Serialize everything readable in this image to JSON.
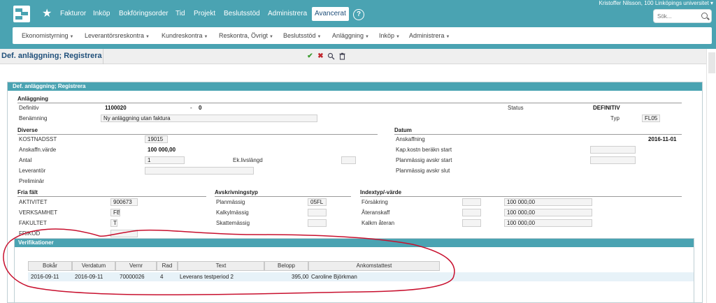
{
  "header": {
    "nav": [
      "Fakturor",
      "Inköp",
      "Bokföringsorder",
      "Tid",
      "Projekt",
      "Beslutsstöd",
      "Administrera",
      "Avancerat"
    ],
    "active_nav": "Avancerat",
    "help_label": "?",
    "user": "Kristoffer Nilsson, 100 Linköpings universitet ▾",
    "search_placeholder": "Sök..."
  },
  "subnav": [
    "Ekonomistyrning",
    "Leverantörsreskontra",
    "Kundreskontra",
    "Reskontra, Övrigt",
    "Beslutsstöd",
    "Anläggning",
    "Inköp",
    "Administrera"
  ],
  "page_title": "Def. anläggning; Registrera",
  "toolbar": {
    "ok": "✔",
    "cancel": "✖"
  },
  "panel": {
    "title": "Def. anläggning; Registrera",
    "anlaggning": {
      "section": "Anläggning",
      "definitiv_label": "Definitiv",
      "definitiv_value": "1100020",
      "definitiv_dash": "-",
      "definitiv_suffix": "0",
      "status_label": "Status",
      "status_value": "DEFINITIV",
      "benamning_label": "Benämning",
      "benamning_value": "Ny anläggning utan faktura",
      "typ_label": "Typ",
      "typ_value": "FL05"
    },
    "diverse": {
      "section": "Diverse",
      "kostnadsst_label": "KOSTNADSST",
      "kostnadsst_value": "19015",
      "anskaffn_label": "Anskaffn.värde",
      "anskaffn_value": "100 000,00",
      "antal_label": "Antal",
      "antal_value": "1",
      "eklivs_label": "Ek.livslängd",
      "eklivs_value": "",
      "leverantor_label": "Leverantör",
      "leverantor_value": "",
      "preliminar_label": "Preliminär"
    },
    "datum": {
      "section": "Datum",
      "anskaffning_label": "Anskaffning",
      "anskaffning_value": "2016-11-01",
      "kapkostn_label": "Kap.kostn beräkn start",
      "planstart_label": "Planmässig avskr start",
      "planslut_label": "Planmässig avskr slut"
    },
    "fria": {
      "section": "Fria fält",
      "aktivitet_label": "AKTIVITET",
      "aktivitet_value": "900673",
      "verksamhet_label": "VERKSAMHET",
      "verksamhet_value": "FB",
      "fakultet_label": "FAKULTET",
      "fakultet_value": "T",
      "frikod_label": "FRIKOD"
    },
    "avskr": {
      "section": "Avskrivningstyp",
      "plan_label": "Planmässig",
      "plan_value": "05FL",
      "kalkyl_label": "Kalkylmässig",
      "skatte_label": "Skattemässig"
    },
    "index": {
      "section": "Indextyp/-värde",
      "forsakring_label": "Försäkring",
      "forsakring_value": "100 000,00",
      "ateranskaff_label": "Återanskaff",
      "ateranskaff_value": "100 000,00",
      "kalkm_label": "Kalkm återan",
      "kalkm_value": "100 000,00"
    }
  },
  "verifikationer": {
    "title": "Verifikationer",
    "columns": [
      "Bokår",
      "Verdatum",
      "Vernr",
      "Rad",
      "Text",
      "Belopp",
      "Ankomstattest"
    ],
    "rows": [
      [
        "2016-09-11",
        "2016-09-11",
        "70000026",
        "4",
        "Leverans testperiod 2",
        "395,00",
        "Caroline Björkman"
      ]
    ]
  },
  "colors": {
    "teal": "#4aa3b2",
    "title_blue": "#1f4f7a",
    "annotation_red": "#c8102e"
  }
}
